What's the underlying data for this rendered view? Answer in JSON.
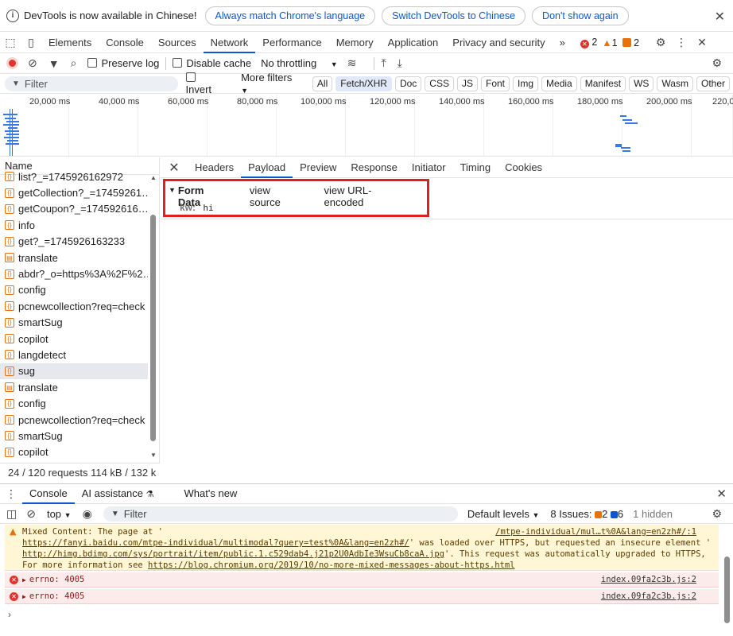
{
  "infobar": {
    "message": "DevTools is now available in Chinese!",
    "btn_match": "Always match Chrome's language",
    "btn_switch": "Switch DevTools to Chinese",
    "btn_dont_show": "Don't show again"
  },
  "main_tabs": [
    "Elements",
    "Console",
    "Sources",
    "Network",
    "Performance",
    "Memory",
    "Application",
    "Privacy and security"
  ],
  "main_tabs_active": "Network",
  "badges": {
    "errors": "2",
    "warnings": "1",
    "issues": "2"
  },
  "net_toolbar": {
    "preserve_log": "Preserve log",
    "disable_cache": "Disable cache",
    "throttling": "No throttling"
  },
  "filter": {
    "placeholder": "Filter",
    "invert": "Invert",
    "more_filters": "More filters",
    "types": [
      "All",
      "Fetch/XHR",
      "Doc",
      "CSS",
      "JS",
      "Font",
      "Img",
      "Media",
      "Manifest",
      "WS",
      "Wasm",
      "Other"
    ],
    "active_type": "Fetch/XHR"
  },
  "timeline": {
    "ticks": [
      "20,000 ms",
      "40,000 ms",
      "60,000 ms",
      "80,000 ms",
      "100,000 ms",
      "120,000 ms",
      "140,000 ms",
      "160,000 ms",
      "180,000 ms",
      "200,000 ms",
      "220,0"
    ]
  },
  "requests": {
    "header": "Name",
    "rows": [
      {
        "name": "list?_=1745926162972",
        "icon": "xhr"
      },
      {
        "name": "getCollection?_=17459261…",
        "icon": "xhr"
      },
      {
        "name": "getCoupon?_=174592616…",
        "icon": "xhr"
      },
      {
        "name": "info",
        "icon": "xhr"
      },
      {
        "name": "get?_=1745926163233",
        "icon": "xhr"
      },
      {
        "name": "translate",
        "icon": "doc"
      },
      {
        "name": "abdr?_o=https%3A%2F%2…",
        "icon": "xhr"
      },
      {
        "name": "config",
        "icon": "xhr"
      },
      {
        "name": "pcnewcollection?req=check",
        "icon": "xhr"
      },
      {
        "name": "smartSug",
        "icon": "xhr"
      },
      {
        "name": "copilot",
        "icon": "xhr"
      },
      {
        "name": "langdetect",
        "icon": "xhr"
      },
      {
        "name": "sug",
        "icon": "xhr",
        "selected": true
      },
      {
        "name": "translate",
        "icon": "doc"
      },
      {
        "name": "config",
        "icon": "xhr"
      },
      {
        "name": "pcnewcollection?req=check",
        "icon": "xhr"
      },
      {
        "name": "smartSug",
        "icon": "xhr"
      },
      {
        "name": "copilot",
        "icon": "xhr"
      }
    ],
    "status": "24 / 120 requests    114 kB / 132 k"
  },
  "detail": {
    "tabs": [
      "Headers",
      "Payload",
      "Preview",
      "Response",
      "Initiator",
      "Timing",
      "Cookies"
    ],
    "active_tab": "Payload",
    "form_data_title": "Form Data",
    "view_source": "view source",
    "view_url_encoded": "view URL-encoded",
    "key": "kw:",
    "value": "hi"
  },
  "drawer": {
    "tabs": [
      "Console",
      "AI assistance",
      "What's new"
    ],
    "active_tab": "Console",
    "context": "top",
    "filter_placeholder": "Filter",
    "levels": "Default levels",
    "issues_label": "8 Issues:",
    "issues_warn": "2",
    "issues_info": "6",
    "hidden": "1 hidden"
  },
  "console": {
    "warning": {
      "text1": "Mixed Content: The page at '",
      "link1": "https://fanyi.baidu.com/mtpe-individual/multimodal?query=test%0A&lang=en2zh#/",
      "text2": "' was loaded over HTTPS, but requested an insecure element '",
      "link2": "http://himg.bdimg.com/sys/portrait/item/public.1.c529dab4.j21p2U0AdbIe3WsuCb8caA.jpg",
      "text3": "'. This request was automatically upgraded to HTTPS, For more information see ",
      "link3": "https://blog.chromium.org/2019/10/no-more-mixed-messages-about-https.html",
      "source": "/mtpe-individual/mul…t%0A&lang=en2zh#/:1"
    },
    "errors": [
      {
        "text": "errno: 4005",
        "source": "index.09fa2c3b.js:2"
      },
      {
        "text": "errno: 4005",
        "source": "index.09fa2c3b.js:2"
      }
    ]
  },
  "colors": {
    "accent": "#0b57d0",
    "highlight": "#e02020",
    "error": "#dc362e",
    "warning": "#e8710a"
  }
}
